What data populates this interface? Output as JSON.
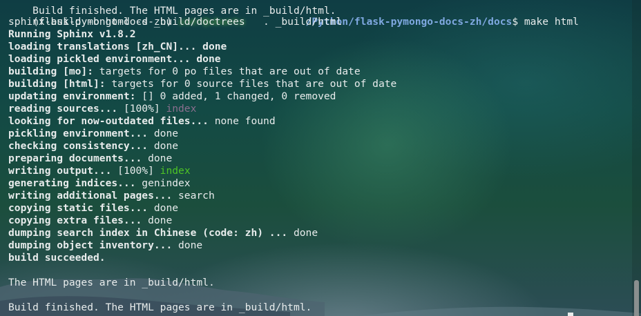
{
  "terminal": {
    "prompt_env": "(flask-pymongo-docs-zh)",
    "prompt_user_host": "user@ubuntu",
    "prompt_path": "/Python/flask-pymongo-docs-zh/docs",
    "prompt_symbol": "$ ",
    "command": "make html",
    "top_partial": "Build finished. The HTML pages are in _build/html.",
    "lines": [
      "sphinx-build -b html -d _build/doctrees   . _build/html",
      "Running Sphinx v1.8.2",
      "loading translations [zh_CN]... done",
      "loading pickled environment... done",
      "building [mo]: targets for 0 po files that are out of date",
      "building [html]: targets for 0 source files that are out of date",
      "updating environment: [] 0 added, 1 changed, 0 removed",
      "reading sources... [100%] ",
      "looking for now-outdated files... none found",
      "pickling environment... done",
      "checking consistency... done",
      "preparing documents... done",
      "writing output... [100%] ",
      "generating indices... genindex",
      "writing additional pages... search",
      "copying static files... done",
      "copying extra files... done",
      "dumping search index in Chinese (code: zh) ... done",
      "dumping object inventory... done",
      "build succeeded.",
      "",
      "The HTML pages are in _build/html.",
      "",
      "Build finished. The HTML pages are in _build/html."
    ],
    "reading_suffix": "index",
    "writing_suffix": "index",
    "colors": {
      "path": "#7fa8e0",
      "dim_index": "#8b6f8f",
      "green_index": "#4ec425",
      "text": "#e8ecec"
    }
  }
}
